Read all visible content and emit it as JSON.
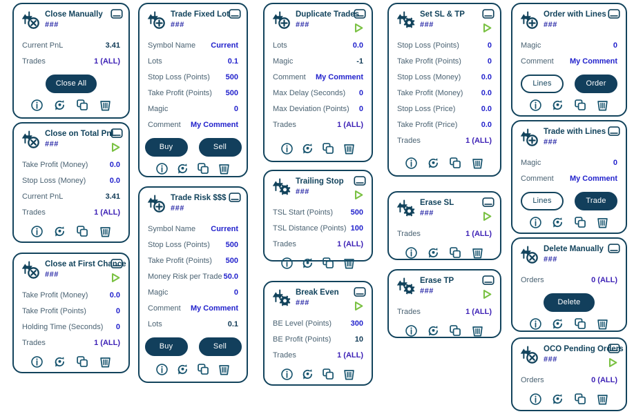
{
  "theme": {
    "card_border": "#12435c",
    "title_color": "#12435c",
    "sub_color": "#2b2ba8",
    "label_color": "#4a6272",
    "value_navy": "#103a56",
    "value_blue": "#2222cc",
    "value_purple": "#3b1fb5",
    "button_fill": "#123f5c",
    "play_green": "#7ac143",
    "background": "#ffffff"
  },
  "common": {
    "subtitle": "###",
    "footer_icons": [
      "info-icon",
      "refresh-icon",
      "copy-icon",
      "trash-icon"
    ],
    "minimize_icon": "minimize-icon",
    "play_icon": "play-icon"
  },
  "cards": [
    {
      "id": "close-manually",
      "title": "Close Manually",
      "subtitle": "###",
      "icon": "arrows-close-icon",
      "minimize": true,
      "play": false,
      "rows": [
        {
          "label": "Current PnL",
          "value": "3.41",
          "tone": "navy"
        },
        {
          "label": "Trades",
          "value": "1 (ALL)",
          "tone": "purple"
        }
      ],
      "buttons": [
        {
          "label": "Close All",
          "style": "filled",
          "wide": true
        }
      ]
    },
    {
      "id": "close-on-total-pnl",
      "title": "Close on Total PnL",
      "subtitle": "###",
      "icon": "arrows-close-icon",
      "minimize": true,
      "play": true,
      "rows": [
        {
          "label": "Take Profit (Money)",
          "value": "0.0",
          "tone": "blue"
        },
        {
          "label": "Stop Loss (Money)",
          "value": "0.0",
          "tone": "blue"
        },
        {
          "label": "Current PnL",
          "value": "3.41",
          "tone": "navy"
        },
        {
          "label": "Trades",
          "value": "1 (ALL)",
          "tone": "purple"
        }
      ],
      "buttons": []
    },
    {
      "id": "close-at-first-chance",
      "title": "Close at First Chance",
      "subtitle": "###",
      "icon": "arrows-close-icon",
      "minimize": true,
      "play": true,
      "rows": [
        {
          "label": "Take Profit (Money)",
          "value": "0.0",
          "tone": "blue"
        },
        {
          "label": "Take Profit (Points)",
          "value": "0",
          "tone": "blue"
        },
        {
          "label": "Holding Time (Seconds)",
          "value": "0",
          "tone": "blue"
        },
        {
          "label": "Trades",
          "value": "1 (ALL)",
          "tone": "purple"
        }
      ],
      "buttons": []
    },
    {
      "id": "trade-fixed-lot",
      "title": "Trade Fixed Lot",
      "subtitle": "###",
      "icon": "arrows-plus-icon",
      "minimize": true,
      "play": false,
      "rows": [
        {
          "label": "Symbol Name",
          "value": "Current",
          "tone": "blue"
        },
        {
          "label": "Lots",
          "value": "0.1",
          "tone": "blue"
        },
        {
          "label": "Stop Loss (Points)",
          "value": "500",
          "tone": "blue"
        },
        {
          "label": "Take Profit (Points)",
          "value": "500",
          "tone": "blue"
        },
        {
          "label": "Magic",
          "value": "0",
          "tone": "blue"
        },
        {
          "label": "Comment",
          "value": "My Comment",
          "tone": "blue"
        }
      ],
      "buttons": [
        {
          "label": "Buy",
          "style": "filled"
        },
        {
          "label": "Sell",
          "style": "filled"
        }
      ]
    },
    {
      "id": "trade-risk",
      "title": "Trade Risk $$$",
      "subtitle": "###",
      "icon": "arrows-plus-icon",
      "minimize": true,
      "play": false,
      "rows": [
        {
          "label": "Symbol Name",
          "value": "Current",
          "tone": "blue"
        },
        {
          "label": "Stop Loss (Points)",
          "value": "500",
          "tone": "blue"
        },
        {
          "label": "Take Profit (Points)",
          "value": "500",
          "tone": "blue"
        },
        {
          "label": "Money Risk per Trade",
          "value": "50.0",
          "tone": "blue"
        },
        {
          "label": "Magic",
          "value": "0",
          "tone": "blue"
        },
        {
          "label": "Comment",
          "value": "My Comment",
          "tone": "blue"
        },
        {
          "label": "Lots",
          "value": "0.1",
          "tone": "navy"
        }
      ],
      "buttons": [
        {
          "label": "Buy",
          "style": "filled"
        },
        {
          "label": "Sell",
          "style": "filled"
        }
      ]
    },
    {
      "id": "duplicate-trades",
      "title": "Duplicate Trades",
      "subtitle": "###",
      "icon": "arrows-plus-icon",
      "minimize": true,
      "play": true,
      "rows": [
        {
          "label": "Lots",
          "value": "0.0",
          "tone": "blue"
        },
        {
          "label": "Magic",
          "value": "-1",
          "tone": "navy"
        },
        {
          "label": "Comment",
          "value": "My Comment",
          "tone": "blue"
        },
        {
          "label": "Max Delay (Seconds)",
          "value": "0",
          "tone": "blue"
        },
        {
          "label": "Max Deviation (Points)",
          "value": "0",
          "tone": "blue"
        },
        {
          "label": "Trades",
          "value": "1 (ALL)",
          "tone": "purple"
        }
      ],
      "buttons": []
    },
    {
      "id": "trailing-stop",
      "title": "Trailing Stop",
      "subtitle": "###",
      "icon": "arrows-gear-icon",
      "minimize": true,
      "play": true,
      "rows": [
        {
          "label": "TSL Start (Points)",
          "value": "500",
          "tone": "blue"
        },
        {
          "label": "TSL Distance (Points)",
          "value": "100",
          "tone": "blue"
        },
        {
          "label": "Trades",
          "value": "1 (ALL)",
          "tone": "purple"
        }
      ],
      "buttons": []
    },
    {
      "id": "break-even",
      "title": "Break Even",
      "subtitle": "###",
      "icon": "arrows-gear-icon",
      "minimize": true,
      "play": true,
      "rows": [
        {
          "label": "BE Level (Points)",
          "value": "300",
          "tone": "blue"
        },
        {
          "label": "BE Profit (Points)",
          "value": "10",
          "tone": "navy"
        },
        {
          "label": "Trades",
          "value": "1 (ALL)",
          "tone": "purple"
        }
      ],
      "buttons": []
    },
    {
      "id": "set-sl-tp",
      "title": "Set SL & TP",
      "subtitle": "###",
      "icon": "arrows-gear-icon",
      "minimize": true,
      "play": true,
      "rows": [
        {
          "label": "Stop Loss (Points)",
          "value": "0",
          "tone": "blue"
        },
        {
          "label": "Take Profit (Points)",
          "value": "0",
          "tone": "blue"
        },
        {
          "label": "Stop Loss (Money)",
          "value": "0.0",
          "tone": "blue"
        },
        {
          "label": "Take Profit (Money)",
          "value": "0.0",
          "tone": "blue"
        },
        {
          "label": "Stop Loss (Price)",
          "value": "0.0",
          "tone": "blue"
        },
        {
          "label": "Take Profit (Price)",
          "value": "0.0",
          "tone": "blue"
        },
        {
          "label": "Trades",
          "value": "1 (ALL)",
          "tone": "purple"
        }
      ],
      "buttons": []
    },
    {
      "id": "erase-sl",
      "title": "Erase SL",
      "subtitle": "###",
      "icon": "arrows-gear-icon",
      "minimize": true,
      "play": true,
      "rows": [
        {
          "label": "Trades",
          "value": "1 (ALL)",
          "tone": "purple"
        }
      ],
      "buttons": []
    },
    {
      "id": "erase-tp",
      "title": "Erase TP",
      "subtitle": "###",
      "icon": "arrows-gear-icon",
      "minimize": true,
      "play": true,
      "rows": [
        {
          "label": "Trades",
          "value": "1 (ALL)",
          "tone": "purple"
        }
      ],
      "buttons": []
    },
    {
      "id": "order-with-lines",
      "title": "Order with Lines",
      "subtitle": "###",
      "icon": "arrows-plus-icon",
      "minimize": true,
      "play": false,
      "rows": [
        {
          "label": "Magic",
          "value": "0",
          "tone": "blue"
        },
        {
          "label": "Comment",
          "value": "My Comment",
          "tone": "blue"
        }
      ],
      "buttons": [
        {
          "label": "Lines",
          "style": "outline"
        },
        {
          "label": "Order",
          "style": "filled"
        }
      ]
    },
    {
      "id": "trade-with-lines",
      "title": "Trade with Lines",
      "subtitle": "###",
      "icon": "arrows-plus-icon",
      "minimize": true,
      "play": false,
      "rows": [
        {
          "label": "Magic",
          "value": "0",
          "tone": "blue"
        },
        {
          "label": "Comment",
          "value": "My Comment",
          "tone": "blue"
        }
      ],
      "buttons": [
        {
          "label": "Lines",
          "style": "outline"
        },
        {
          "label": "Trade",
          "style": "filled"
        }
      ]
    },
    {
      "id": "delete-manually",
      "title": "Delete Manually",
      "subtitle": "###",
      "icon": "arrows-close-icon",
      "minimize": true,
      "play": false,
      "rows": [
        {
          "label": "Orders",
          "value": "0 (ALL)",
          "tone": "purple"
        }
      ],
      "buttons": [
        {
          "label": "Delete",
          "style": "filled",
          "wide": true
        }
      ]
    },
    {
      "id": "oco-pending-orders",
      "title": "OCO Pending Orders",
      "subtitle": "###",
      "icon": "arrows-close-icon",
      "minimize": true,
      "play": true,
      "rows": [
        {
          "label": "Orders",
          "value": "0 (ALL)",
          "tone": "purple"
        }
      ],
      "buttons": []
    }
  ]
}
